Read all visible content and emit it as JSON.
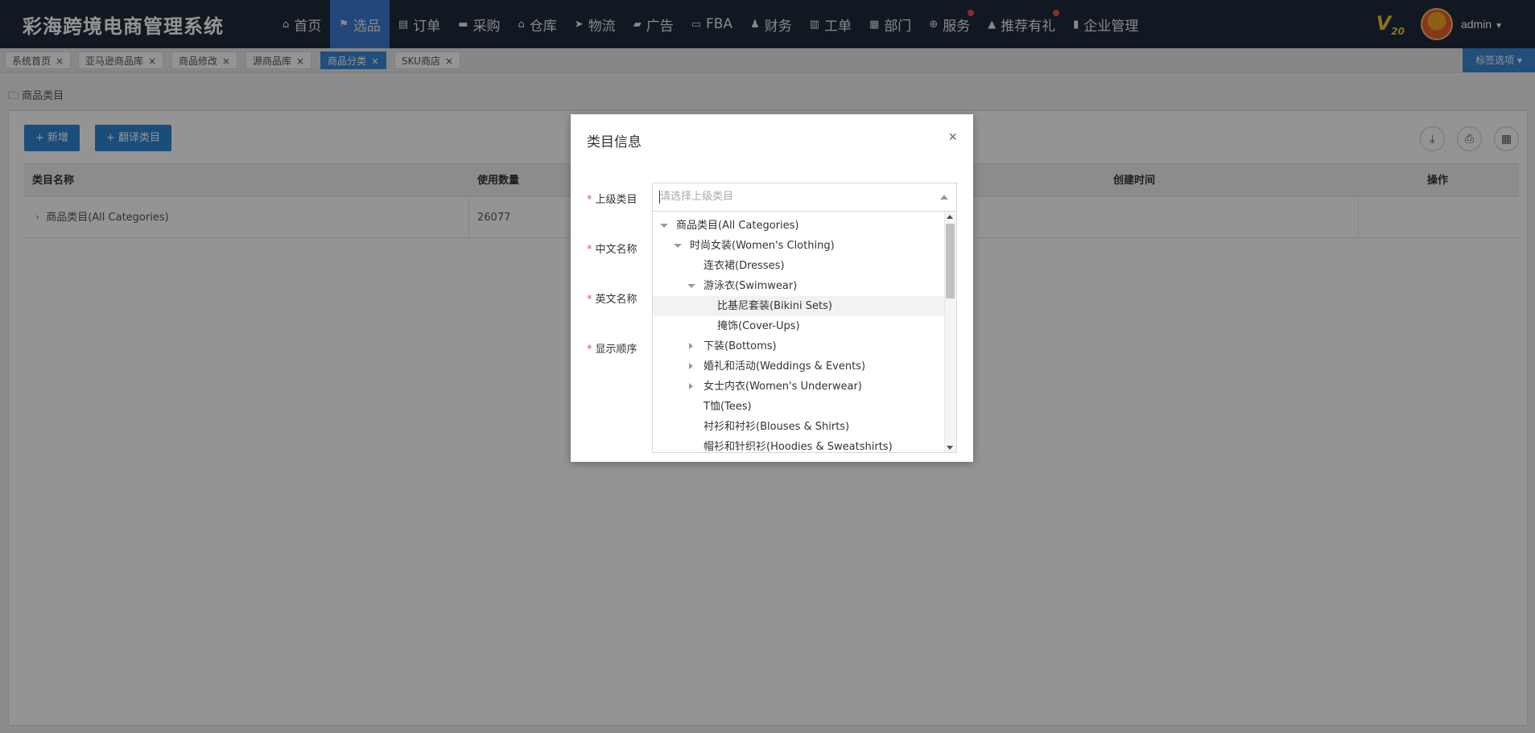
{
  "app": {
    "title": "彩海跨境电商管理系统",
    "version_badge": "V",
    "version_sub": "20",
    "user": "admin"
  },
  "nav": [
    {
      "label": "首页",
      "icon": "home-icon"
    },
    {
      "label": "选品",
      "icon": "flag-icon",
      "active": true
    },
    {
      "label": "订单",
      "icon": "clipboard-icon"
    },
    {
      "label": "采购",
      "icon": "cart-icon"
    },
    {
      "label": "仓库",
      "icon": "warehouse-icon"
    },
    {
      "label": "物流",
      "icon": "plane-icon"
    },
    {
      "label": "广告",
      "icon": "comment-icon"
    },
    {
      "label": "FBA",
      "icon": "truck-icon"
    },
    {
      "label": "财务",
      "icon": "user-icon"
    },
    {
      "label": "工单",
      "icon": "ticket-icon"
    },
    {
      "label": "部门",
      "icon": "grid-icon"
    },
    {
      "label": "服务",
      "icon": "plus-circle-icon",
      "dot": true
    },
    {
      "label": "推荐有礼",
      "icon": "gift-icon",
      "dot": true
    },
    {
      "label": "企业管理",
      "icon": "bar-chart-icon"
    }
  ],
  "tabs": [
    {
      "label": "系统首页"
    },
    {
      "label": "亚马逊商品库"
    },
    {
      "label": "商品修改"
    },
    {
      "label": "源商品库"
    },
    {
      "label": "商品分类",
      "active": true
    },
    {
      "label": "SKU商店"
    }
  ],
  "tag_options": "标签选项",
  "breadcrumb": "商品类目",
  "toolbar": {
    "add_label": "+ 新增",
    "translate_label": "+ 翻译类目"
  },
  "table": {
    "columns": [
      "类目名称",
      "使用数量",
      "创建时间",
      "操作"
    ],
    "rows": [
      {
        "name": "商品类目(All Categories)",
        "count": "26077"
      }
    ]
  },
  "modal": {
    "title": "类目信息",
    "close": "×",
    "fields": {
      "parent": "上级类目",
      "cn_name": "中文名称",
      "en_name": "英文名称",
      "order": "显示顺序"
    },
    "parent_placeholder": "请选择上级类目",
    "tree": [
      {
        "label": "商品类目(All Categories)",
        "level": 0,
        "state": "open"
      },
      {
        "label": "时尚女装(Women's Clothing)",
        "level": 1,
        "state": "open"
      },
      {
        "label": "连衣裙(Dresses)",
        "level": 2,
        "state": "leaf"
      },
      {
        "label": "游泳衣(Swimwear)",
        "level": 2,
        "state": "open"
      },
      {
        "label": "比基尼套装(Bikini Sets)",
        "level": 3,
        "state": "leaf",
        "hover": true
      },
      {
        "label": "掩饰(Cover-Ups)",
        "level": 3,
        "state": "leaf"
      },
      {
        "label": "下装(Bottoms)",
        "level": 2,
        "state": "closed"
      },
      {
        "label": "婚礼和活动(Weddings & Events)",
        "level": 2,
        "state": "closed"
      },
      {
        "label": "女士内衣(Women's Underwear)",
        "level": 2,
        "state": "closed"
      },
      {
        "label": "T恤(Tees)",
        "level": 2,
        "state": "leaf"
      },
      {
        "label": "衬衫和衬衫(Blouses & Shirts)",
        "level": 2,
        "state": "leaf"
      },
      {
        "label": "帽衫和针织衫(Hoodies & Sweatshirts)",
        "level": 2,
        "state": "leaf"
      }
    ]
  }
}
